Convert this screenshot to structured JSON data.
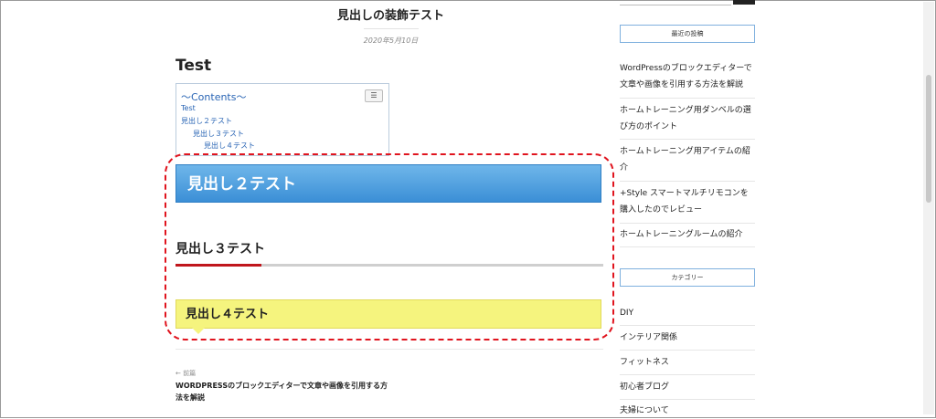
{
  "post": {
    "title": "見出しの装飾テスト",
    "date": "2020年5月10日",
    "heading_test": "Test"
  },
  "toc": {
    "title": "〜Contents〜",
    "toggle_icon": "list-toggle-icon",
    "items": [
      "Test",
      "見出し２テスト",
      "見出し３テスト",
      "見出し４テスト"
    ]
  },
  "headings": {
    "h2": "見出し２テスト",
    "h3": "見出し３テスト",
    "h4": "見出し４テスト"
  },
  "nav": {
    "prev_label": "← 前篇",
    "prev_title": "WORDPRESSのブロックエディターで文章や画像を引用する方法を解説"
  },
  "sidebar": {
    "recent_title": "最近の投稿",
    "recent_posts": [
      "WordPressのブロックエディターで文章や画像を引用する方法を解説",
      "ホームトレーニング用ダンベルの選び方のポイント",
      "ホームトレーニング用アイテムの紹介",
      "+Style スマートマルチリモコンを購入したのでレビュー",
      "ホームトレーニングルームの紹介"
    ],
    "category_title": "カテゴリー",
    "categories": [
      "DIY",
      "インテリア関係",
      "フィットネス",
      "初心者ブログ",
      "夫婦について"
    ]
  },
  "colors": {
    "h2_blue": "#3b8fd6",
    "h3_accent": "#c0161c",
    "h4_yellow": "#f5f47e",
    "highlight_red": "#e0141e",
    "link_blue": "#2864b4"
  }
}
